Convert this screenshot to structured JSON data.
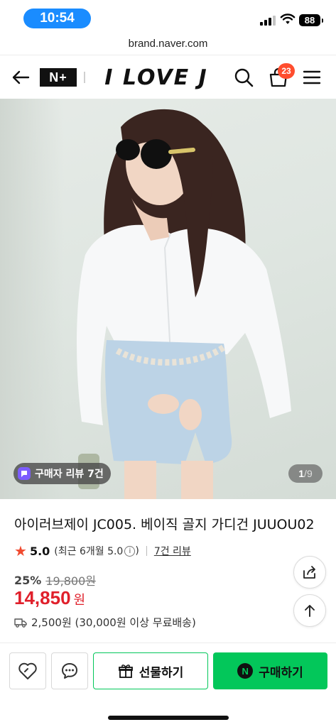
{
  "status_bar": {
    "time": "10:54",
    "battery": "88"
  },
  "browser": {
    "url": "brand.naver.com"
  },
  "header": {
    "nplus_label": "N+",
    "brand_name": "I LOVE J",
    "cart_count": "23"
  },
  "gallery": {
    "review_chip": "구매자 리뷰 7건",
    "current_page": "1",
    "page_separator": "/",
    "total_pages": "9"
  },
  "product": {
    "title": "아이러브제이 JC005. 베이직 골지 가디건 JUUOU02",
    "rating": "5.0",
    "rating_detail": "(최근 6개월 5.0",
    "rating_detail_close": ")",
    "review_link": "7건 리뷰",
    "discount_rate": "25%",
    "original_price": "19,800원",
    "price": "14,850",
    "currency": "원",
    "shipping": "2,500원 (30,000원 이상 무료배송)"
  },
  "actions": {
    "gift_label": "선물하기",
    "buy_label": "구매하기"
  },
  "colors": {
    "naver_green": "#03c75a",
    "price_red": "#e0202b",
    "badge_orange": "#ff4d2e",
    "star": "#f04a2f"
  },
  "icons": [
    "back-arrow-icon",
    "search-icon",
    "shopping-bag-icon",
    "menu-icon",
    "share-icon",
    "scroll-top-icon",
    "like-icon",
    "talk-icon",
    "gift-icon",
    "truck-icon",
    "star-icon",
    "info-icon"
  ]
}
